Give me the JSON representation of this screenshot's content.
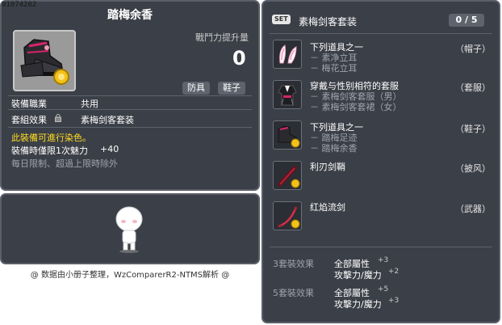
{
  "item_id": "01074202",
  "item_name": "踏梅余香",
  "power_label": "戰鬥力提升量",
  "power_value": "0",
  "tags": [
    "防具",
    "鞋子"
  ],
  "job_label": "裝備職業",
  "job_value": "共用",
  "set_effect_label": "套組效果",
  "set_effect_value": "素梅剑客套装",
  "dye_text": "此裝備可進行染色。",
  "time_charm_label": "裝備時僅限1次魅力",
  "time_charm_value": "+40",
  "daily_limit_text": "每日限制、超過上限時除外",
  "footer_text": "@ 数据由小册子整理，WzComparerR2-NTMS解析 @",
  "set_panel": {
    "badge": "SET",
    "title": "素梅剑客套装",
    "count": "0 / 5",
    "items": [
      {
        "lines": [
          "下列道具之一",
          "－ 素净立耳",
          "－ 梅花立耳"
        ],
        "category": "（帽子）",
        "icon": "ears-icon"
      },
      {
        "lines": [
          "穿戴与性别相符的套服",
          "－ 素梅剑客套服（男）",
          "－ 素梅剑客套裙（女）"
        ],
        "category": "（套服）",
        "icon": "outfit-icon"
      },
      {
        "lines": [
          "下列道具之一",
          "－ 踏梅足迹",
          "－ 踏梅余香"
        ],
        "category": "（鞋子）",
        "icon": "shoe-icon"
      },
      {
        "lines": [
          "利刃剑鞘"
        ],
        "category": "（披风）",
        "icon": "scabbard-icon"
      },
      {
        "lines": [
          "红焰流剑"
        ],
        "category": "（武器）",
        "icon": "sword-icon"
      }
    ],
    "effects": [
      {
        "label": "3套裝效果",
        "stats": [
          {
            "name": "全部屬性",
            "value": "+3"
          },
          {
            "name": "攻擊力/魔力",
            "value": "+2"
          }
        ]
      },
      {
        "label": "5套裝效果",
        "stats": [
          {
            "name": "全部屬性",
            "value": "+5"
          },
          {
            "name": "攻擊力/魔力",
            "value": "+3"
          }
        ]
      }
    ]
  },
  "colors": {
    "panel_bg": "#3b3f47",
    "border": "#5a5f69",
    "yellow": "#ffdd22",
    "gray_text": "#9ea3ac"
  }
}
